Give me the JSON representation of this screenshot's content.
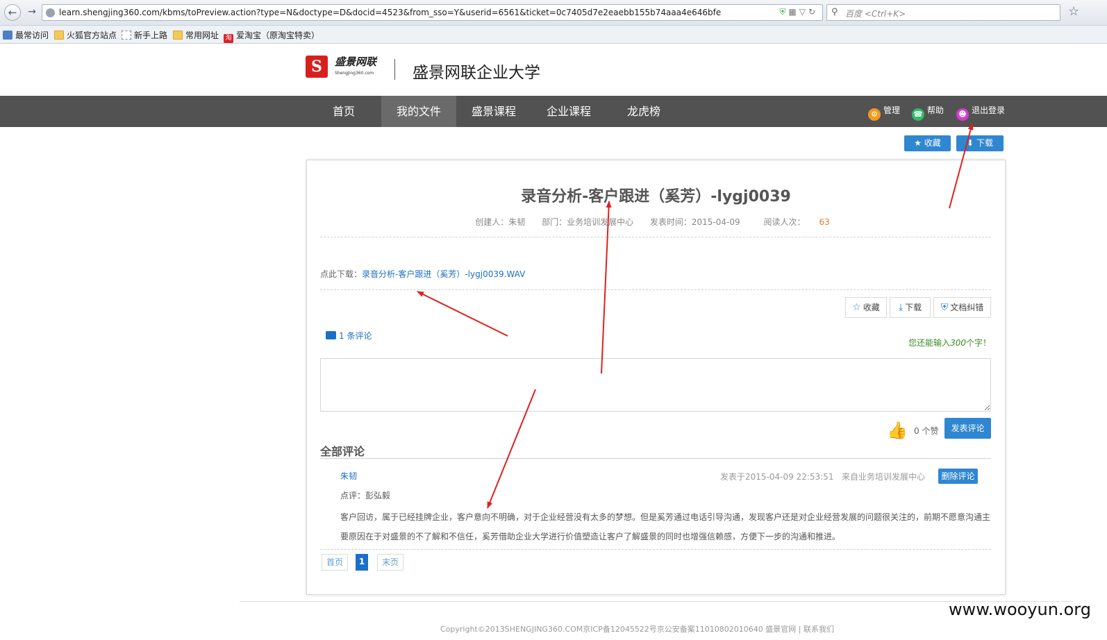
{
  "browser": {
    "url": "learn.shengjing360.com/kbms/toPreview.action?type=N&doctype=D&docid=4523&from_sso=Y&userid=6561&ticket=0c7405d7e2eaebb155b74aaa4e646bfe",
    "search_placeholder": "百度 <Ctrl+K>",
    "bookmarks": [
      "最常访问",
      "火狐官方站点",
      "新手上路",
      "常用网址",
      "爱淘宝（原淘宝特卖）"
    ]
  },
  "site": {
    "logo_cn": "盛景网联",
    "logo_en": "ShengJing360.com",
    "title": "盛景网联企业大学"
  },
  "nav": {
    "items": [
      "首页",
      "我的文件",
      "盛景课程",
      "企业课程",
      "龙虎榜"
    ],
    "active": "我的文件",
    "links": [
      "管理",
      "帮助",
      "退出登录"
    ]
  },
  "top_buttons": {
    "favorite": "收藏",
    "download": "下载"
  },
  "document": {
    "title": "录音分析-客户跟进（奚芳）-lygj0039",
    "creator": "创建人：朱韧",
    "department": "部门：业务培训发展中心",
    "published": "发表时间：2015-04-09",
    "views_label": "阅读人次：",
    "views": "63",
    "download_label": "点此下载：",
    "download_file": "录音分析-客户跟进（奚芳）-lygj0039.WAV"
  },
  "actions": {
    "favorite": "收藏",
    "download": "下载",
    "report": "文档纠错"
  },
  "comments": {
    "count_label": "1 条评论",
    "remain_prefix": "您还能输入",
    "remain_num": "300",
    "remain_suffix": "个字！",
    "likes": "0 个赞",
    "submit": "发表评论",
    "all_title": "全部评论",
    "items": [
      {
        "author": "朱韧",
        "date": "发表于2015-04-09 22:53:51",
        "dept": "来自业务培训发展中心",
        "delete": "删除评论",
        "review": "点评：彭弘毅",
        "body": "客户回访，属于已经挂牌企业，客户意向不明确，对于企业经营没有太多的梦想。但是奚芳通过电话引导沟通，发现客户还是对企业经营发展的问题很关注的，前期不愿意沟通主要原因在于对盛景的不了解和不信任，奚芳借助企业大学进行价值塑造让客户了解盛景的同时也增强信赖感，方便下一步的沟通和推进。"
      }
    ]
  },
  "pager": {
    "first": "首页",
    "current": "1",
    "last": "末页"
  },
  "footer": "Copyright©2013SHENGJING360.COM京ICP备12045522号京公安备案11010802010640 盛景官网 | 联系我们",
  "watermark": "www.wooyun.org",
  "colors": {
    "nav_bg": "#525252",
    "accent": "#2f86d1",
    "arrow": "#e0201c"
  }
}
